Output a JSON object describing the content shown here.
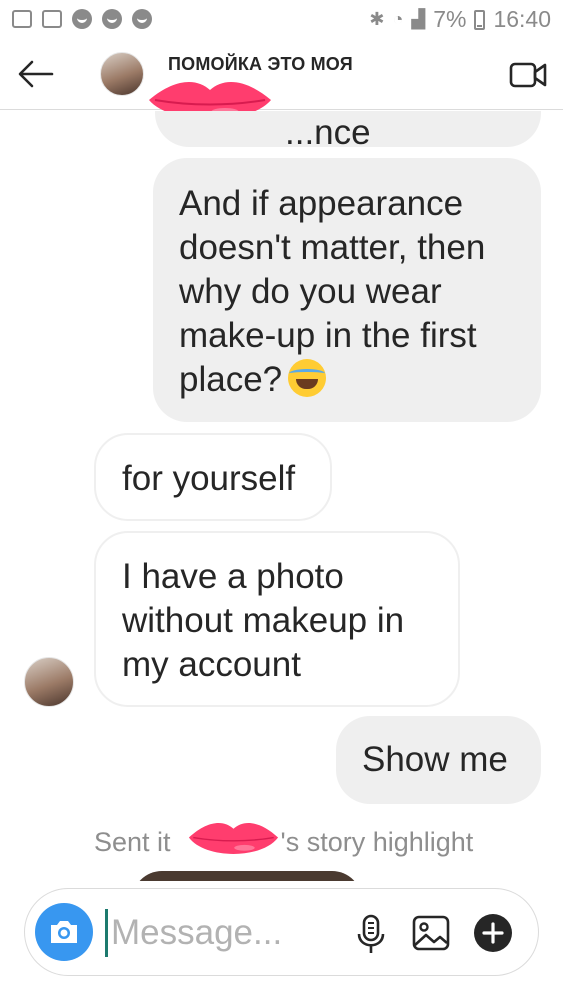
{
  "status_bar": {
    "battery_percent": "7%",
    "time": "16:40"
  },
  "header": {
    "title": "ПОМОЙКА ЭТО МОЯ"
  },
  "messages": [
    {
      "id": "m0",
      "direction": "outgoing",
      "text": "...nce"
    },
    {
      "id": "m1",
      "direction": "outgoing",
      "text": "And if appearance doesn't matter, then why do you wear make-up in the first place?",
      "emoji": "face-with-tears-of-joy"
    },
    {
      "id": "m2",
      "direction": "incoming",
      "text": "for yourself"
    },
    {
      "id": "m3",
      "direction": "incoming",
      "text": "I have a photo without makeup in my account"
    },
    {
      "id": "m4",
      "direction": "outgoing",
      "text": "Show me"
    }
  ],
  "story_note": {
    "prefix": "Sent it",
    "suffix": "'s story highlight"
  },
  "composer": {
    "placeholder": "Message..."
  },
  "colors": {
    "accent": "#3897f0",
    "bubble_out": "#efefef",
    "redaction": "#ff3d6e"
  }
}
